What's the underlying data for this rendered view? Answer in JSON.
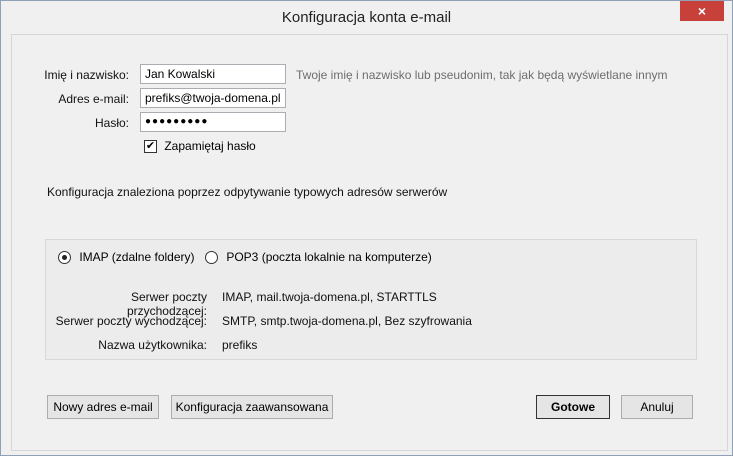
{
  "window": {
    "title": "Konfiguracja konta e-mail",
    "close_glyph": "×"
  },
  "form": {
    "name_label": "Imię i nazwisko:",
    "name_value": "Jan Kowalski",
    "name_hint": "Twoje imię i nazwisko lub pseudonim, tak jak będą wyświetlane innym",
    "email_label": "Adres e-mail:",
    "email_value": "prefiks@twoja-domena.pl",
    "password_label": "Hasło:",
    "password_value": "●●●●●●●●●",
    "remember_label": "Zapamiętaj hasło",
    "remember_checked": true
  },
  "status_text": "Konfiguracja znaleziona poprzez odpytywanie typowych adresów serwerów",
  "protocol": {
    "imap_label": "IMAP (zdalne foldery)",
    "pop3_label": "POP3 (poczta lokalnie na komputerze)",
    "selected": "imap"
  },
  "servers": {
    "incoming_label": "Serwer poczty przychodzącej:",
    "incoming_value": "IMAP, mail.twoja-domena.pl, STARTTLS",
    "outgoing_label": "Serwer poczty wychodzącej:",
    "outgoing_value": "SMTP, smtp.twoja-domena.pl, Bez szyfrowania",
    "username_label": "Nazwa użytkownika:",
    "username_value": "prefiks"
  },
  "buttons": {
    "new_address": "Nowy adres e-mail",
    "advanced": "Konfiguracja zaawansowana",
    "done": "Gotowe",
    "cancel": "Anuluj"
  },
  "icons": {
    "close": "close-icon",
    "check": "checkmark-icon"
  }
}
